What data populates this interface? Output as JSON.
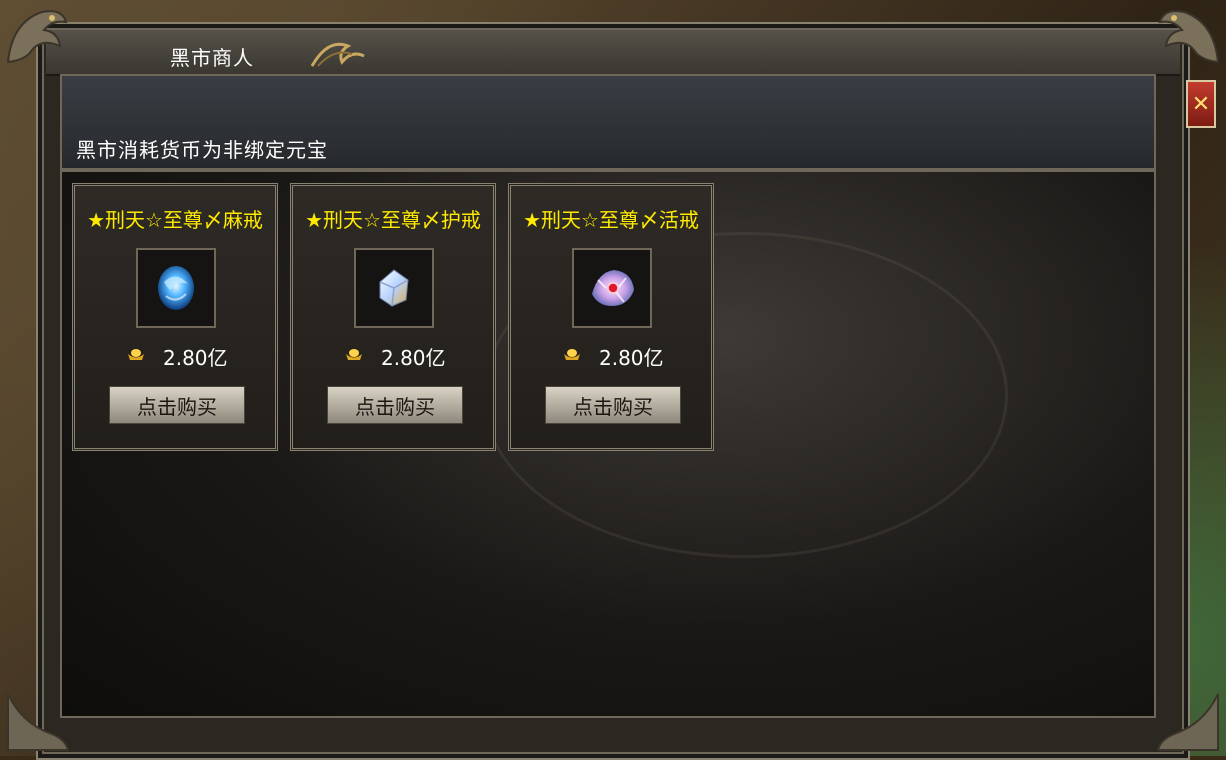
{
  "window": {
    "title": "黑市商人",
    "close_label": "✕"
  },
  "notice": "黑市消耗货币为非绑定元宝",
  "items": [
    {
      "name": "★刑天☆至尊〆麻戒",
      "price": "2.80亿",
      "buy_label": "点击购买",
      "icon": "blue-ring-icon"
    },
    {
      "name": "★刑天☆至尊〆护戒",
      "price": "2.80亿",
      "buy_label": "点击购买",
      "icon": "crystal-ring-icon"
    },
    {
      "name": "★刑天☆至尊〆活戒",
      "price": "2.80亿",
      "buy_label": "点击购买",
      "icon": "pink-ring-icon"
    }
  ],
  "colors": {
    "item_name": "#ffea00",
    "close_button": "#c23b2e",
    "frame": "#8a8270"
  }
}
